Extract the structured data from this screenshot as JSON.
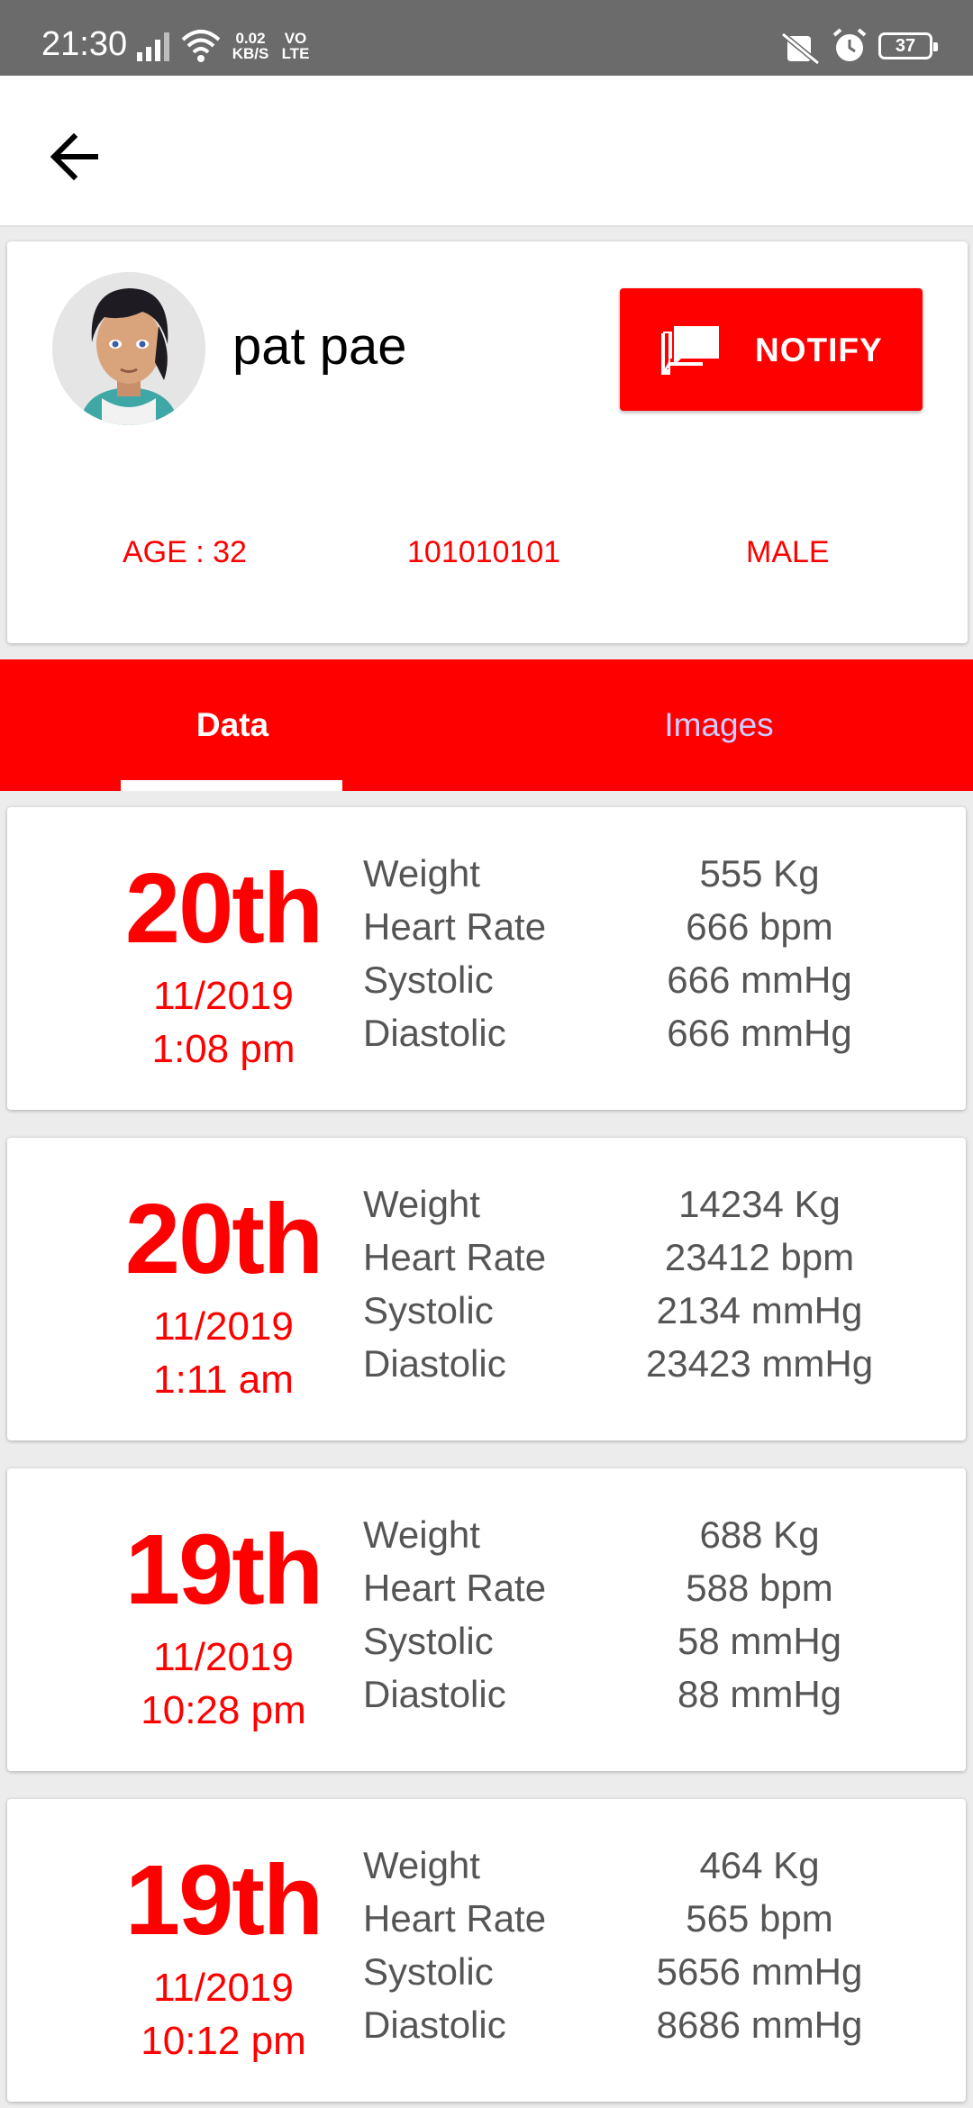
{
  "status_bar": {
    "time": "21:30",
    "net_speed_top": "0.02",
    "net_speed_bottom": "KB/S",
    "volte_top": "VO",
    "volte_bottom": "LTE",
    "battery": "37",
    "icons": [
      "signal-icon",
      "wifi-icon",
      "mute-icon",
      "alarm-icon",
      "battery-icon"
    ]
  },
  "app_bar": {
    "back_icon": "arrow-left-icon"
  },
  "patient": {
    "name": "pat pae",
    "age": "AGE : 32",
    "id": "101010101",
    "gender": "MALE"
  },
  "notify_button": {
    "label": "NOTIFY",
    "icon": "chat-icon"
  },
  "tabs": [
    {
      "label": "Data",
      "selected": true
    },
    {
      "label": "Images",
      "selected": false
    }
  ],
  "colors": {
    "accent": "#ff0000",
    "tab_inactive": "#ccccff",
    "text_gray": "#555555"
  },
  "records": [
    {
      "day": "20th",
      "month": "11/2019",
      "time": "1:08 pm",
      "rows": [
        {
          "label": "Weight",
          "value": "555 Kg"
        },
        {
          "label": "Heart Rate",
          "value": "666 bpm"
        },
        {
          "label": "Systolic",
          "value": "666 mmHg"
        },
        {
          "label": "Diastolic",
          "value": "666 mmHg"
        }
      ]
    },
    {
      "day": "20th",
      "month": "11/2019",
      "time": "1:11 am",
      "rows": [
        {
          "label": "Weight",
          "value": "14234 Kg"
        },
        {
          "label": "Heart Rate",
          "value": "23412 bpm"
        },
        {
          "label": "Systolic",
          "value": "2134 mmHg"
        },
        {
          "label": "Diastolic",
          "value": "23423 mmHg"
        }
      ]
    },
    {
      "day": "19th",
      "month": "11/2019",
      "time": "10:28 pm",
      "rows": [
        {
          "label": "Weight",
          "value": "688 Kg"
        },
        {
          "label": "Heart Rate",
          "value": "588 bpm"
        },
        {
          "label": "Systolic",
          "value": "58 mmHg"
        },
        {
          "label": "Diastolic",
          "value": "88 mmHg"
        }
      ]
    },
    {
      "day": "19th",
      "month": "11/2019",
      "time": "10:12 pm",
      "rows": [
        {
          "label": "Weight",
          "value": "464 Kg"
        },
        {
          "label": "Heart Rate",
          "value": "565 bpm"
        },
        {
          "label": "Systolic",
          "value": "5656 mmHg"
        },
        {
          "label": "Diastolic",
          "value": "8686 mmHg"
        }
      ]
    }
  ]
}
